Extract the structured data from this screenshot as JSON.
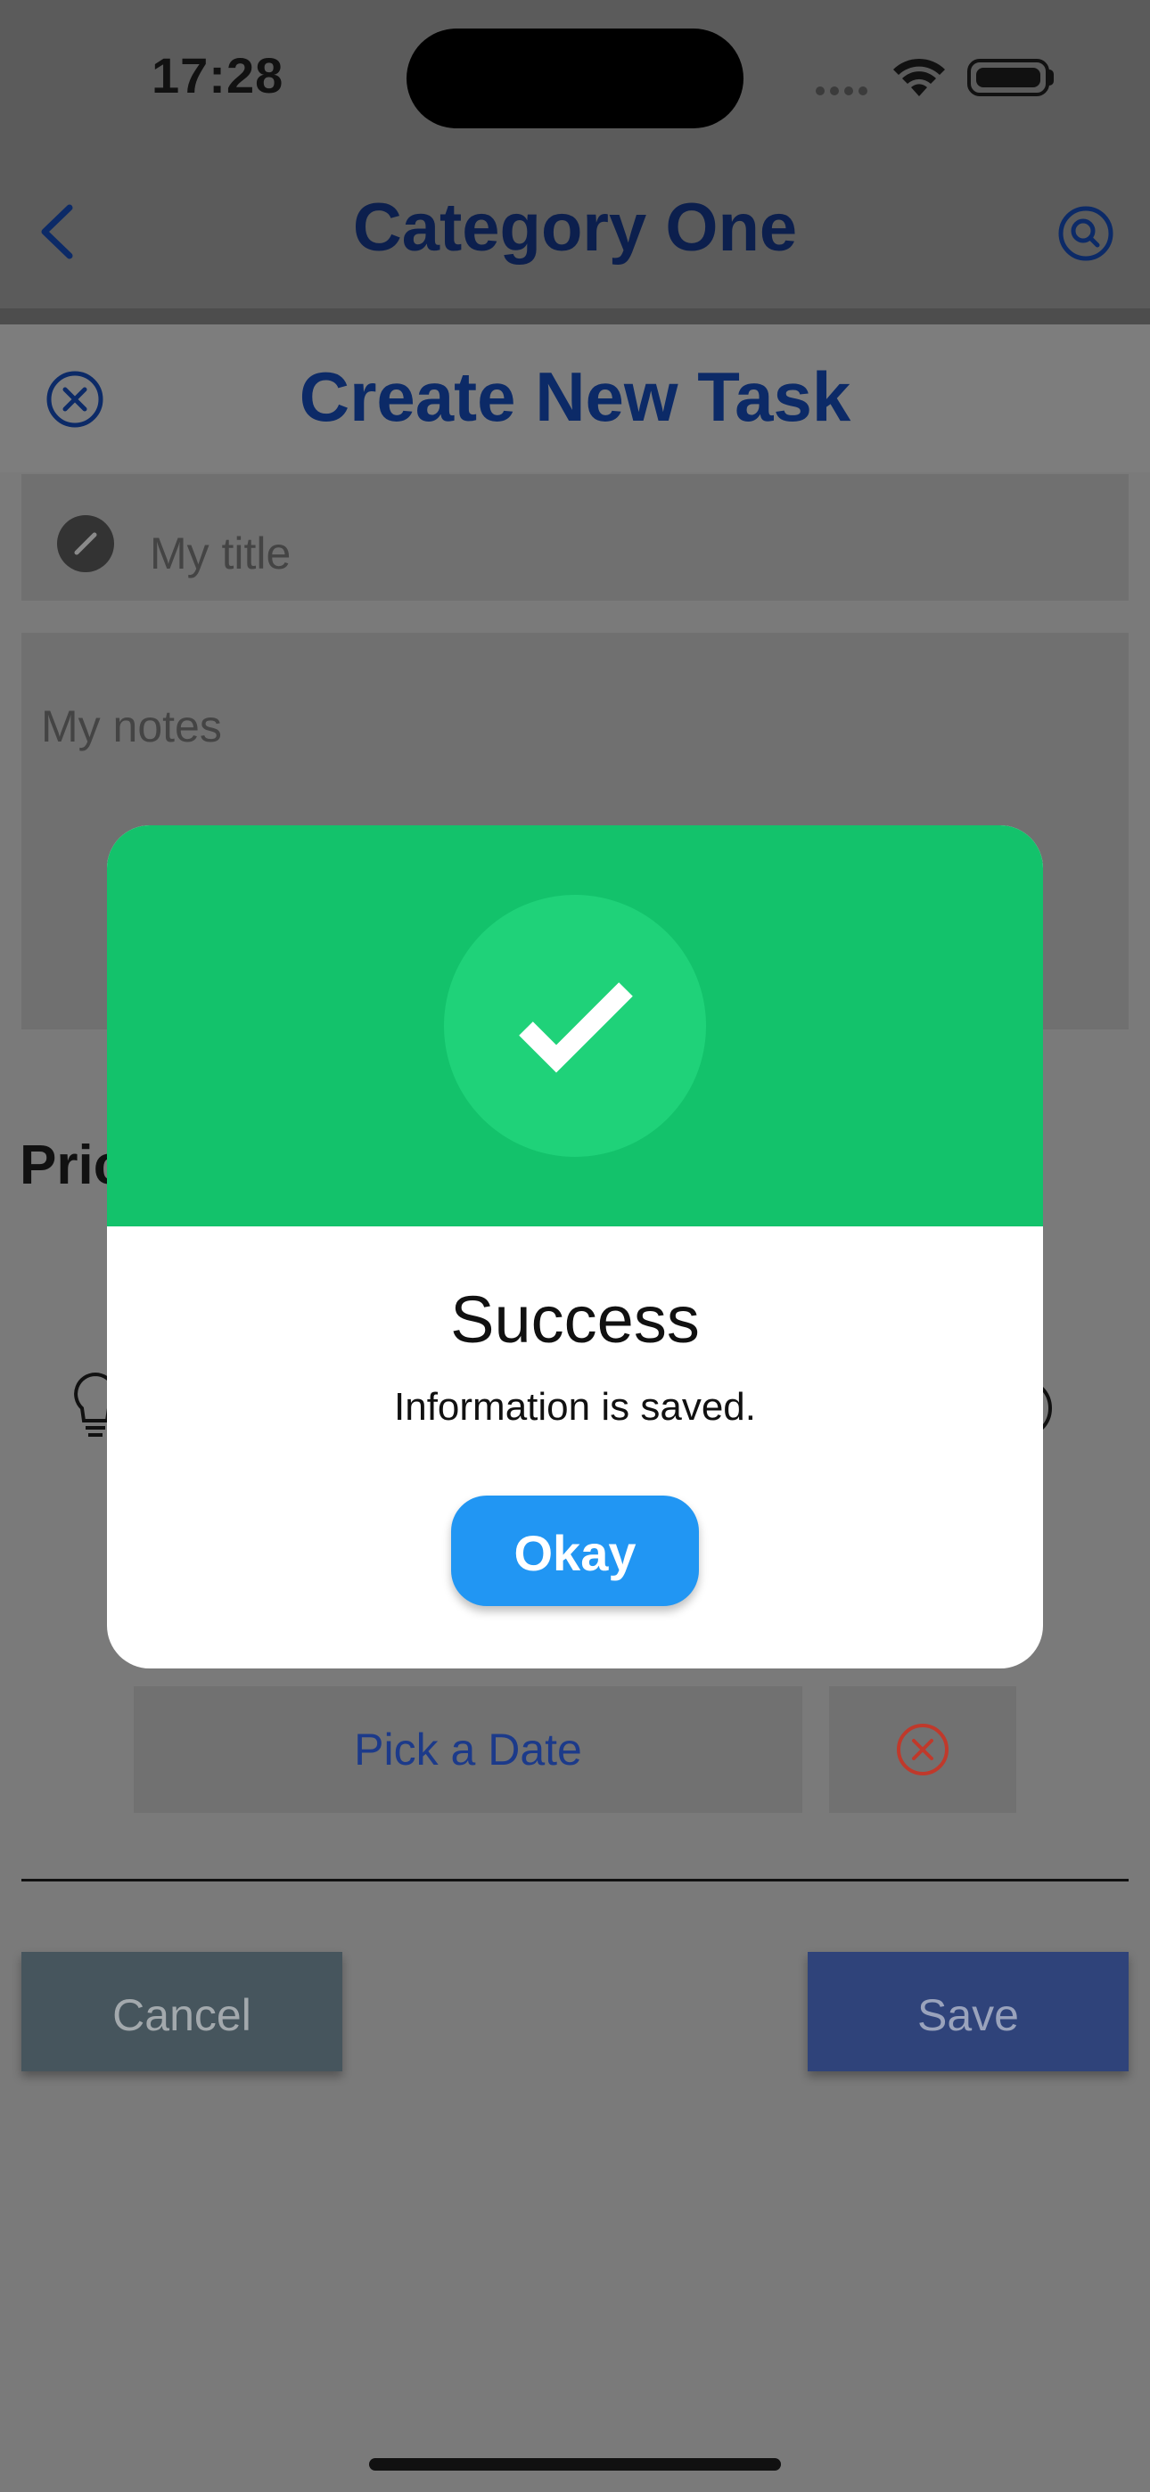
{
  "status_bar": {
    "time": "17:28"
  },
  "header": {
    "title": "Category One",
    "back_icon": "chevron-left-icon",
    "search_icon": "search-icon"
  },
  "sheet": {
    "title": "Create New Task",
    "close_icon": "close-circle-icon",
    "title_placeholder": "My title",
    "notes_placeholder": "My notes",
    "priority_label": "Pric",
    "pick_date_label": "Pick a Date",
    "cancel_label": "Cancel",
    "save_label": "Save"
  },
  "modal": {
    "title": "Success",
    "message": "Information is saved.",
    "okay_label": "Okay",
    "icon": "checkmark-icon"
  },
  "colors": {
    "accent_navy": "#0c2a67",
    "success_green": "#13c26b",
    "okay_blue": "#2196f3",
    "danger_red": "#c0392b"
  }
}
